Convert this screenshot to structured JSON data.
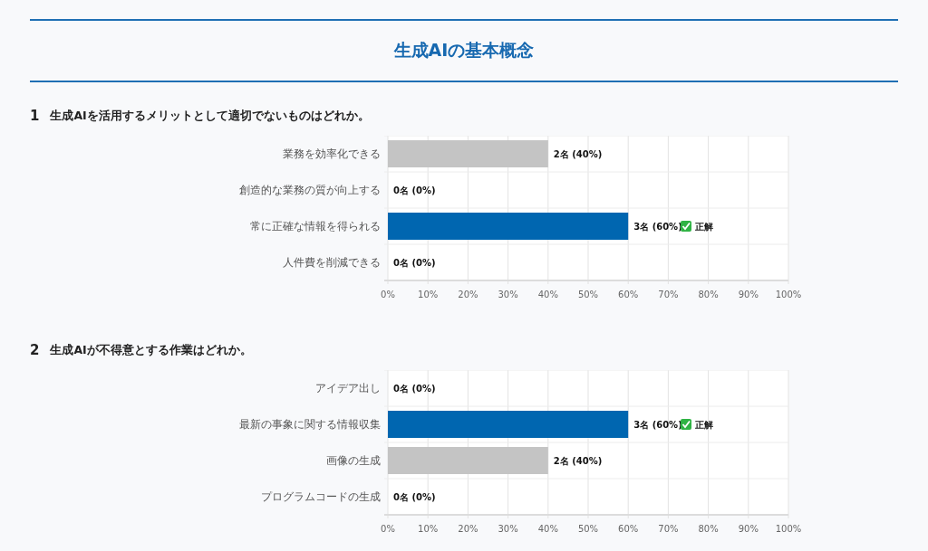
{
  "title": "生成AIの基本概念",
  "questions": [
    {
      "number": "1",
      "text": "生成AIを活用するメリットとして適切でないものはどれか。",
      "chart_data": {
        "type": "bar",
        "orientation": "horizontal",
        "grid": true,
        "categories": [
          "業務を効率化できる",
          "創造的な業務の質が向上する",
          "常に正確な情報を得られる",
          "人件費を削減できる"
        ],
        "series": [
          {
            "color": "#c4c4c4",
            "values": [
              40,
              0,
              null,
              0
            ]
          },
          {
            "color": "#0066b0",
            "values": [
              null,
              null,
              60,
              null
            ]
          }
        ],
        "value_labels": [
          "2名 (40%)",
          "0名 (0%)",
          "3名 (60%)",
          "0名 (0%)"
        ],
        "annotations": [
          "正解"
        ],
        "xlim": [
          0,
          100
        ],
        "xticks": [
          {
            "value": 0,
            "label": "0%"
          },
          {
            "value": 10,
            "label": "10%"
          },
          {
            "value": 20,
            "label": "20%"
          },
          {
            "value": 30,
            "label": "30%"
          },
          {
            "value": 40,
            "label": "40%"
          },
          {
            "value": 50,
            "label": "50%"
          },
          {
            "value": 60,
            "label": "60%"
          },
          {
            "value": 70,
            "label": "70%"
          },
          {
            "value": 80,
            "label": "80%"
          },
          {
            "value": 90,
            "label": "90%"
          },
          {
            "value": 100,
            "label": "100%"
          }
        ]
      }
    },
    {
      "number": "2",
      "text": "生成AIが不得意とする作業はどれか。",
      "chart_data": {
        "type": "bar",
        "orientation": "horizontal",
        "grid": true,
        "categories": [
          "アイデア出し",
          "最新の事象に関する情報収集",
          "画像の生成",
          "プログラムコードの生成"
        ],
        "series": [
          {
            "color": "#c4c4c4",
            "values": [
              0,
              null,
              40,
              0
            ]
          },
          {
            "color": "#0066b0",
            "values": [
              null,
              60,
              null,
              null
            ]
          }
        ],
        "value_labels": [
          "0名 (0%)",
          "3名 (60%)",
          "2名 (40%)",
          "0名 (0%)"
        ],
        "annotations": [
          "正解"
        ],
        "xlim": [
          0,
          100
        ],
        "xticks": [
          {
            "value": 0,
            "label": "0%"
          },
          {
            "value": 10,
            "label": "10%"
          },
          {
            "value": 20,
            "label": "20%"
          },
          {
            "value": 30,
            "label": "30%"
          },
          {
            "value": 40,
            "label": "40%"
          },
          {
            "value": 50,
            "label": "50%"
          },
          {
            "value": 60,
            "label": "60%"
          },
          {
            "value": 70,
            "label": "70%"
          },
          {
            "value": 80,
            "label": "80%"
          },
          {
            "value": 90,
            "label": "90%"
          },
          {
            "value": 100,
            "label": "100%"
          }
        ]
      }
    }
  ]
}
